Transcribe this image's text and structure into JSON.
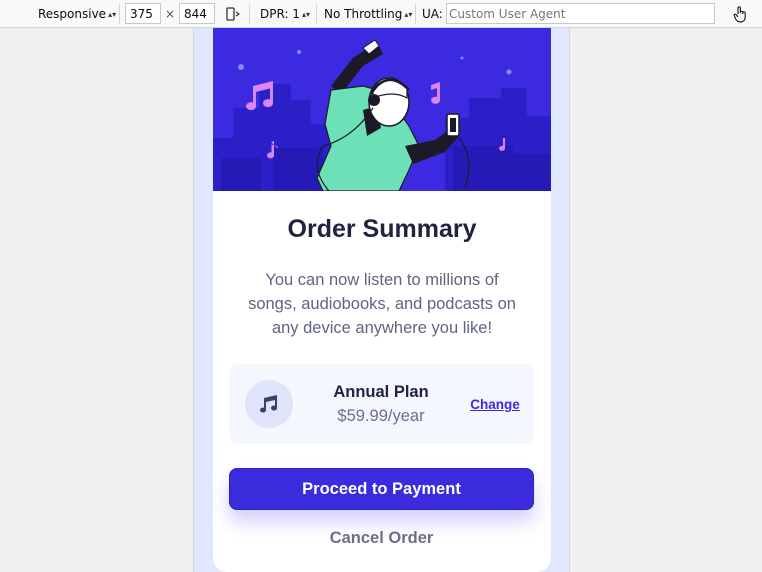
{
  "toolbar": {
    "device_label": "Responsive",
    "width_value": "375",
    "times": "×",
    "height_value": "844",
    "dpr_label": "DPR: 1",
    "throttling_label": "No Throttling",
    "ua_label": "UA:",
    "ua_placeholder": "Custom User Agent",
    "icons": [
      "rotate-device-icon",
      "touch-simulation-icon"
    ]
  },
  "card": {
    "title": "Order Summary",
    "description": "You can now listen to millions of songs, audiobooks, and podcasts on any device anywhere you like!",
    "plan": {
      "icon": "music-note-icon",
      "name": "Annual Plan",
      "price": "$59.99/year",
      "change_label": "Change"
    },
    "pay_label": "Proceed to Payment",
    "cancel_label": "Cancel Order"
  },
  "colors": {
    "accent": "#3a2bdc",
    "hero_bg": "#3b2ae0",
    "page_bg": "#e0e8ff",
    "title": "#1f2340",
    "muted": "#6b6f8a"
  }
}
